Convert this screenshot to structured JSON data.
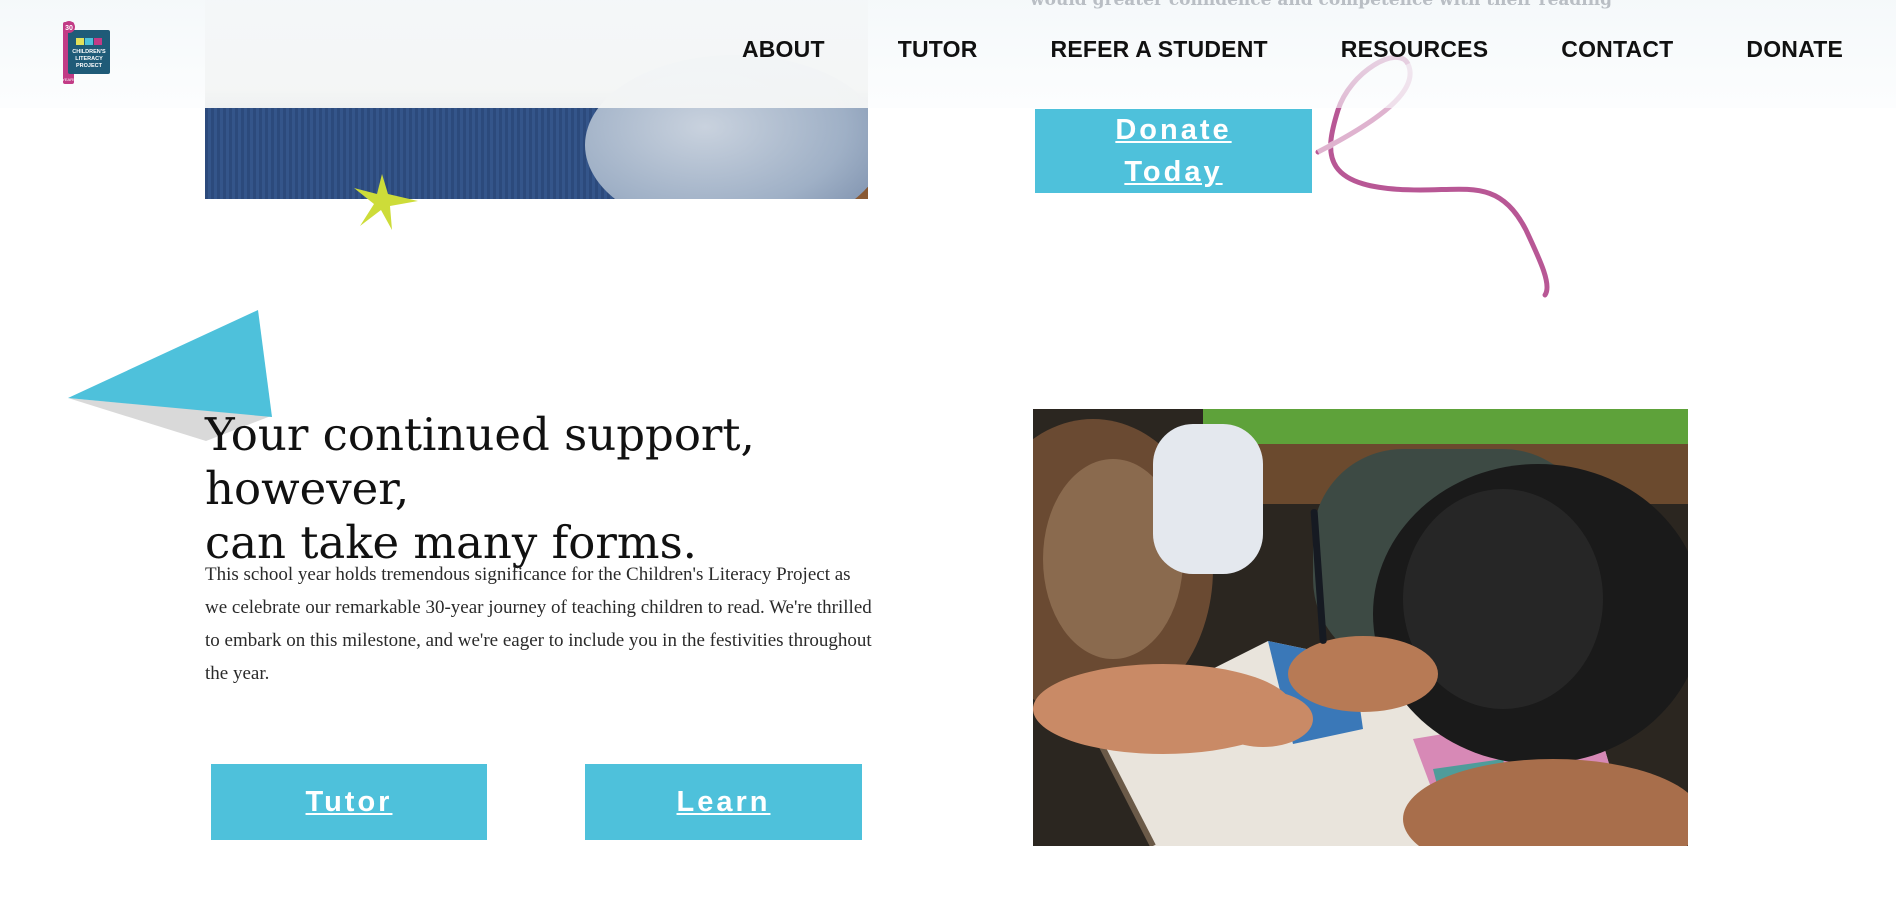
{
  "header": {
    "faded_line": "would greater confidence and competence with their reading",
    "logo": {
      "badge": "30",
      "line1": "CHILDREN'S",
      "line2": "LITERACY",
      "line3": "PROJECT",
      "years": "YEARS"
    },
    "nav": [
      "ABOUT",
      "TUTOR",
      "REFER A STUDENT",
      "RESOURCES",
      "CONTACT",
      "DONATE"
    ]
  },
  "donate_cta": {
    "label_line1": "Donate",
    "label_line2": "Today"
  },
  "support": {
    "heading_line1": "Your continued support, however,",
    "heading_line2": "can take many forms.",
    "paragraph": "This school year holds tremendous significance for the Children's Literacy Project as we celebrate our remarkable 30-year journey of teaching children to read. We're thrilled to embark on this milestone, and we're eager to include you in the festivities throughout the year.",
    "buttons": {
      "tutor": "Tutor",
      "learn": "Learn"
    }
  },
  "colors": {
    "accent": "#4ec1db",
    "squiggle": "#b0458a",
    "star": "#cddc39",
    "heading": "#111111"
  },
  "icons": {
    "star": "star-burst-icon",
    "triangle": "triangle-decoration",
    "squiggle": "squiggle-decoration"
  }
}
